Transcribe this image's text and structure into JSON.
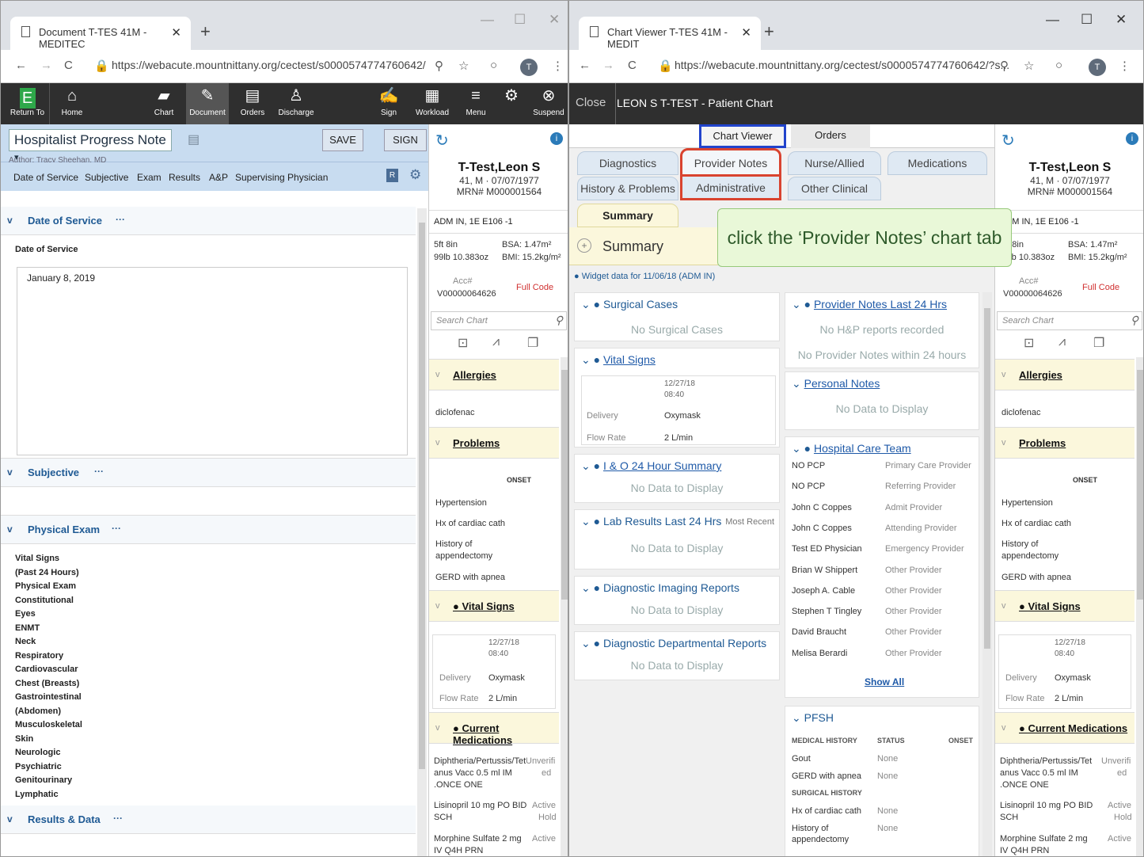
{
  "left": {
    "tab_title": "Document T-TES 41M - MEDITEC",
    "url": "https://webacute.mountnittany.org/cectest/s0000574774760642/",
    "toolbar": {
      "return": "Return To",
      "home": "Home",
      "chart": "Chart",
      "document": "Document",
      "orders": "Orders",
      "discharge": "Discharge",
      "sign": "Sign",
      "workload": "Workload",
      "menu": "Menu",
      "suspend": "Suspend"
    },
    "note_type": "Hospitalist Progress Note",
    "save": "SAVE",
    "sign": "SIGN",
    "author": "Author: Tracy Sheehan, MD",
    "nav": [
      "Date of Service",
      "Subjective",
      "Exam",
      "Results",
      "A&P",
      "Supervising Physician"
    ],
    "badge": "R",
    "sections": {
      "dos": "Date of Service",
      "subjective": "Subjective",
      "exam": "Physical Exam",
      "results": "Results & Data"
    },
    "dos_label": "Date of Service",
    "dos_value": "January 8, 2019",
    "exam_items": [
      "Vital Signs",
      "(Past 24 Hours)",
      "Physical Exam",
      "Constitutional",
      "Eyes",
      "ENMT",
      "Neck",
      "Respiratory",
      "Cardiovascular",
      "Chest (Breasts)",
      "Gastrointestinal",
      "(Abdomen)",
      "Musculoskeletal",
      "Skin",
      "Neurologic",
      "Psychiatric",
      "Genitourinary",
      "Lymphatic"
    ]
  },
  "side": {
    "name": "T-Test,Leon S",
    "demo": "41, M · 07/07/1977",
    "mrn": "MRN# M000001564",
    "loc": "ADM IN, 1E E106 -1",
    "height": "5ft 8in",
    "weight": "99lb 10.383oz",
    "bsa": "BSA: 1.47m²",
    "bmi": "BMI: 15.2kg/m²",
    "acc_label": "Acc#",
    "acc": "V00000064626",
    "code": "Full Code",
    "search": "Search Chart",
    "allergies": "Allergies",
    "allergy1": "diclofenac",
    "problems": "Problems",
    "onset": "ONSET",
    "prob": [
      "Hypertension",
      "Hx of cardiac cath",
      "History of",
      "appendectomy",
      "GERD with apnea"
    ],
    "vitals": "Vital Signs",
    "vdate": "12/27/18",
    "vtime": "08:40",
    "delivery": "Delivery",
    "oxymask": "Oxymask",
    "flow": "Flow Rate",
    "flowval": "2 L/min",
    "meds": "Current Medications",
    "med1a": "Diphtheria/Pertussis/Tet",
    "med1b": "anus Vacc 0.5 ml IM",
    "med1c": ".ONCE ONE",
    "med1s": "Unverifi",
    "med1s2": "ed",
    "med2a": "Lisinopril 10 mg PO BID",
    "med2b": "SCH",
    "med2s": "Active",
    "med2s2": "Hold",
    "med3a": "Morphine Sulfate 2 mg",
    "med3b": "IV Q4H PRN",
    "med3s": "Active"
  },
  "right": {
    "tab_title": "Chart Viewer T-TES 41M - MEDIT",
    "url": "https://webacute.mountnittany.org/cectest/s0000574774760642/?s...",
    "close": "Close",
    "chart_title": "LEON S T-TEST - Patient Chart",
    "top_tabs": [
      "Chart Viewer",
      "Orders"
    ],
    "row1": [
      "Diagnostics",
      "Provider Notes",
      "Nurse/Allied Health",
      "Medications"
    ],
    "row2": [
      "History & Problems",
      "Administrative",
      "Other Clinical"
    ],
    "summary_tab": "Summary",
    "summary_head": "Summary",
    "widget": "Widget data for 11/06/18 (ADM IN)",
    "callout": "click the ‘Provider Notes’ chart tab",
    "surg": "Surgical Cases",
    "surg_nd": "No Surgical Cases",
    "vitals": "Vital Signs",
    "io": "I & O 24 Hour Summary",
    "nd": "No Data to Display",
    "lab": "Lab Results Last 24 Hrs",
    "most_recent": "Most Recent",
    "dir": "Diagnostic Imaging Reports",
    "ddr": "Diagnostic Departmental Reports",
    "pn": "Provider Notes Last 24 Hrs",
    "pn1": "No H&P reports recorded",
    "pn2": "No Provider Notes within 24 hours",
    "personal": "Personal Notes",
    "hct": "Hospital Care Team",
    "team": [
      [
        "NO PCP",
        "Primary Care Provider"
      ],
      [
        "NO PCP",
        "Referring Provider"
      ],
      [
        "John C Coppes",
        "Admit Provider"
      ],
      [
        "John C Coppes",
        "Attending Provider"
      ],
      [
        "Test ED Physician",
        "Emergency Provider"
      ],
      [
        "Brian W Shippert",
        "Other Provider"
      ],
      [
        "Joseph A. Cable",
        "Other Provider"
      ],
      [
        "Stephen T Tingley",
        "Other Provider"
      ],
      [
        "David Braucht",
        "Other Provider"
      ],
      [
        "Melisa Berardi",
        "Other Provider"
      ]
    ],
    "show_all": "Show All",
    "pfsh": "PFSH",
    "mh": "MEDICAL HISTORY",
    "status": "STATUS",
    "onset": "ONSET",
    "pf": [
      [
        "Gout",
        "None"
      ],
      [
        "GERD with apnea",
        "None"
      ]
    ],
    "sh": "SURGICAL HISTORY",
    "pf2": [
      [
        "Hx of cardiac cath",
        "None"
      ],
      [
        "History of",
        "None"
      ]
    ],
    "pf2b": "appendectomy"
  }
}
